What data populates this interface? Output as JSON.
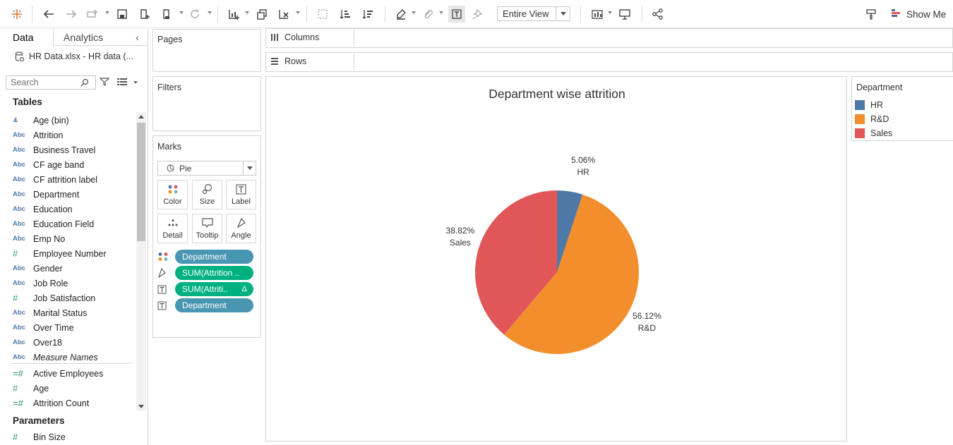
{
  "toolbar": {
    "fit_label": "Entire View",
    "show_me_label": "Show Me"
  },
  "data_pane": {
    "tabs": [
      "Data",
      "Analytics"
    ],
    "collapse_icon": "chevron-left-icon",
    "source_label": "HR Data.xlsx - HR data (...",
    "search_placeholder": "Search",
    "tables_heading": "Tables",
    "parameters_heading": "Parameters",
    "fields": [
      {
        "type": "bin",
        "name": "Age (bin)"
      },
      {
        "type": "Abc",
        "name": "Attrition"
      },
      {
        "type": "Abc",
        "name": "Business Travel"
      },
      {
        "type": "Abc",
        "name": "CF age band"
      },
      {
        "type": "Abc",
        "name": "CF attrition label"
      },
      {
        "type": "Abc",
        "name": "Department"
      },
      {
        "type": "Abc",
        "name": "Education"
      },
      {
        "type": "Abc",
        "name": "Education Field"
      },
      {
        "type": "Abc",
        "name": "Emp No"
      },
      {
        "type": "#",
        "name": "Employee Number"
      },
      {
        "type": "Abc",
        "name": "Gender"
      },
      {
        "type": "Abc",
        "name": "Job Role"
      },
      {
        "type": "#",
        "name": "Job Satisfaction"
      },
      {
        "type": "Abc",
        "name": "Marital Status"
      },
      {
        "type": "Abc",
        "name": "Over Time"
      },
      {
        "type": "Abc",
        "name": "Over18"
      },
      {
        "type": "Abc",
        "name": "Measure Names",
        "italic": true
      },
      {
        "type": "=#",
        "name": "Active Employees"
      },
      {
        "type": "#",
        "name": "Age"
      },
      {
        "type": "=#",
        "name": "Attrition Count"
      }
    ],
    "parameters": [
      {
        "type": "#",
        "name": "Bin Size"
      }
    ]
  },
  "cards": {
    "pages_title": "Pages",
    "filters_title": "Filters",
    "marks_title": "Marks",
    "mark_type": "Pie",
    "mark_buttons": [
      "Color",
      "Size",
      "Label",
      "Detail",
      "Tooltip",
      "Angle"
    ],
    "pills": [
      {
        "icon": "color-dots-icon",
        "label": "Department",
        "kind": "dimension"
      },
      {
        "icon": "angle-icon",
        "label": "SUM(Attrition ..",
        "kind": "measure"
      },
      {
        "icon": "label-icon",
        "label": "SUM(Attriti..",
        "kind": "measure",
        "delta": "Δ"
      },
      {
        "icon": "label-icon",
        "label": "Department",
        "kind": "dimension"
      }
    ]
  },
  "shelves": {
    "columns_label": "Columns",
    "rows_label": "Rows"
  },
  "legend": {
    "title": "Department",
    "items": [
      {
        "label": "HR",
        "color": "#4e79a7"
      },
      {
        "label": "R&D",
        "color": "#f28e2b"
      },
      {
        "label": "Sales",
        "color": "#e15759"
      }
    ]
  },
  "chart_data": {
    "type": "pie",
    "title": "Department wise attrition",
    "slices": [
      {
        "label": "HR",
        "value": 5.06,
        "display": "5.06%",
        "color": "#4e79a7"
      },
      {
        "label": "R&D",
        "value": 56.12,
        "display": "56.12%",
        "color": "#f28e2b"
      },
      {
        "label": "Sales",
        "value": 38.82,
        "display": "38.82%",
        "color": "#e15759"
      }
    ]
  }
}
